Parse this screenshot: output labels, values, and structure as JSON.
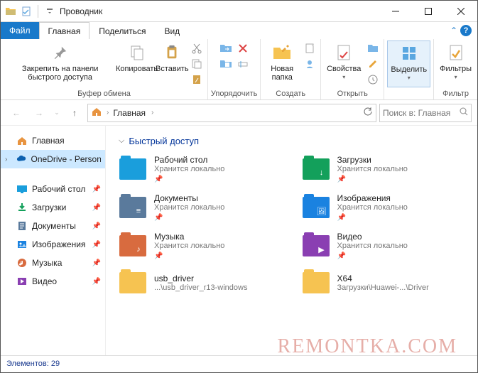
{
  "window": {
    "title": "Проводник"
  },
  "tabs": {
    "file": "Файл",
    "home": "Главная",
    "share": "Поделиться",
    "view": "Вид"
  },
  "ribbon": {
    "pin_label": "Закрепить на панели быстрого доступа",
    "copy_label": "Копировать",
    "paste_label": "Вставить",
    "clipboard_group": "Буфер обмена",
    "organize_group": "Упорядочить",
    "new_folder_label": "Новая папка",
    "create_group": "Создать",
    "properties_label": "Свойства",
    "open_group": "Открыть",
    "select_label": "Выделить",
    "filters_label": "Фильтры",
    "filter_group": "Фильтр"
  },
  "address": {
    "crumb1": "Главная"
  },
  "search": {
    "placeholder": "Поиск в: Главная"
  },
  "sidebar": {
    "home": "Главная",
    "onedrive": "OneDrive - Personal",
    "desktop": "Рабочий стол",
    "downloads": "Загрузки",
    "documents": "Документы",
    "pictures": "Изображения",
    "music": "Музыка",
    "videos": "Видео"
  },
  "main": {
    "section": "Быстрый доступ",
    "items": [
      {
        "name": "Рабочий стол",
        "sub": "Хранится локально",
        "pin": true,
        "color": "#1a9edc",
        "glyph": ""
      },
      {
        "name": "Загрузки",
        "sub": "Хранится локально",
        "pin": true,
        "color": "#13a05b",
        "glyph": "↓"
      },
      {
        "name": "Документы",
        "sub": "Хранится локально",
        "pin": true,
        "color": "#5a7a9c",
        "glyph": "≡"
      },
      {
        "name": "Изображения",
        "sub": "Хранится локально",
        "pin": true,
        "color": "#1a82e0",
        "glyph": "🖼"
      },
      {
        "name": "Музыка",
        "sub": "Хранится локально",
        "pin": true,
        "color": "#d86b3f",
        "glyph": "♪"
      },
      {
        "name": "Видео",
        "sub": "Хранится локально",
        "pin": true,
        "color": "#8a3fb2",
        "glyph": "▶"
      },
      {
        "name": "usb_driver",
        "sub": "...\\usb_driver_r13-windows",
        "pin": false,
        "color": "#f6c351",
        "glyph": ""
      },
      {
        "name": "X64",
        "sub": "Загрузки\\Huawei-...\\Driver",
        "pin": false,
        "color": "#f6c351",
        "glyph": ""
      }
    ]
  },
  "status": {
    "count_label": "Элементов:",
    "count": "29"
  },
  "watermark": "REMONTKA.COM"
}
